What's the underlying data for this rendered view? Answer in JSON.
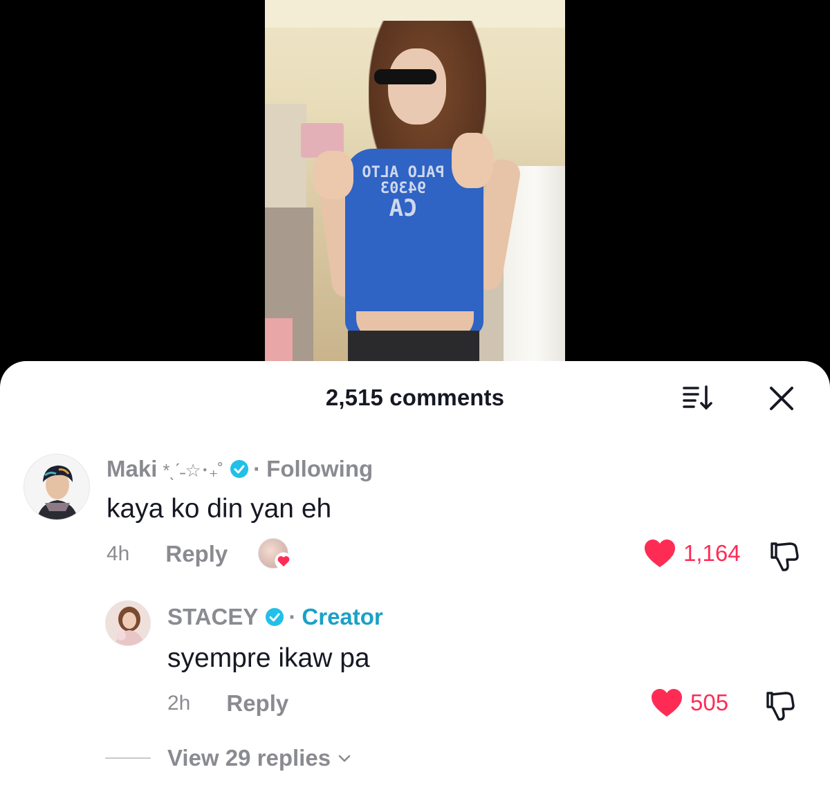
{
  "sheet": {
    "title": "2,515 comments"
  },
  "comments": [
    {
      "username": "Maki",
      "name_decoration": "*ˎˊ˗☆･₊˚",
      "verified": true,
      "relation": "Following",
      "text": "kaya ko din yan eh",
      "time": "4h",
      "reply_label": "Reply",
      "liked_by_creator": true,
      "likes": "1,164",
      "liked": true
    },
    {
      "username": "STACEY",
      "verified": true,
      "relation": "Creator",
      "text": "syempre ikaw pa",
      "time": "2h",
      "reply_label": "Reply",
      "likes": "505",
      "liked": true
    }
  ],
  "view_replies": {
    "label": "View 29 replies"
  },
  "video": {
    "shirt_text_line1": "PALO ALTO",
    "shirt_text_line2": "94303",
    "shirt_text_line3": "CA"
  },
  "colors": {
    "like_red": "#fe2c55",
    "verified_blue": "#20c0e8",
    "creator_blue": "#1aa1c7",
    "muted_gray": "#8a8b91",
    "text_dark": "#161823"
  },
  "icons": {
    "sort": "sort-icon",
    "close": "close-icon",
    "verified": "verified-badge-icon",
    "heart": "heart-icon",
    "dislike": "dislike-icon",
    "chevron": "chevron-down-icon"
  }
}
